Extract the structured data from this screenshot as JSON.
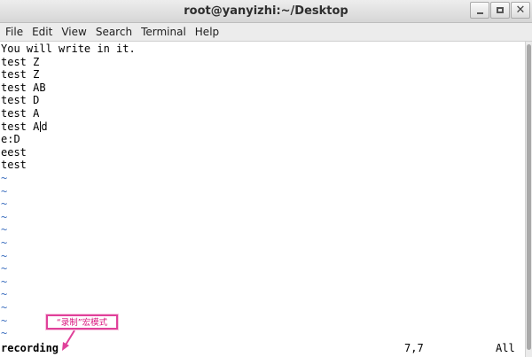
{
  "window": {
    "title": "root@yanyizhi:~/Desktop"
  },
  "menu": [
    "File",
    "Edit",
    "View",
    "Search",
    "Terminal",
    "Help"
  ],
  "editor": {
    "lines": [
      "You will write in it.",
      "test Z",
      "test Z",
      "test AB",
      "test D",
      "test A",
      "test A",
      "e:D",
      "eest",
      "test"
    ],
    "cursor_line_before": "test A",
    "cursor_line_after": "d",
    "tilde": "~",
    "tilde_count": 13
  },
  "statusline": {
    "mode": "recording",
    "position": "7,7",
    "scroll": "All"
  },
  "annotation": {
    "text": "“录制”宏模式"
  },
  "colors": {
    "tilde": "#3d6fbf",
    "annotation": "#e0419a"
  },
  "icons": [
    "minimize-icon",
    "maximize-icon",
    "close-icon",
    "arrow-icon"
  ]
}
